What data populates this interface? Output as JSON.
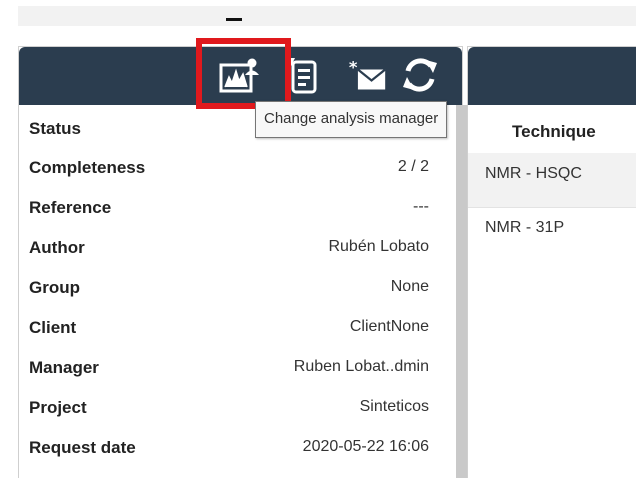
{
  "colors": {
    "toolbar_bg": "#2b3d4f",
    "highlight": "#e0191d",
    "shaded_row": "#f2f2f2",
    "scrollbar": "#c9c9c9"
  },
  "toolbar": {
    "icons": [
      "analysis-manager-icon",
      "request-form-icon",
      "mail-icon",
      "refresh-icon"
    ]
  },
  "tooltip": {
    "text": "Change analysis manager"
  },
  "details": {
    "rows": [
      {
        "label": "Status",
        "value": ""
      },
      {
        "label": "Completeness",
        "value": "2 / 2"
      },
      {
        "label": "Reference",
        "value": "---"
      },
      {
        "label": "Author",
        "value": "Rubén Lobato"
      },
      {
        "label": "Group",
        "value": "None"
      },
      {
        "label": "Client",
        "value": "ClientNone"
      },
      {
        "label": "Manager",
        "value": "Ruben Lobat..dmin"
      },
      {
        "label": "Project",
        "value": "Sinteticos"
      },
      {
        "label": "Request date",
        "value": "2020-05-22 16:06"
      }
    ]
  },
  "techniques": {
    "header": "Technique",
    "rows": [
      "NMR - HSQC",
      "NMR - 31P"
    ]
  }
}
